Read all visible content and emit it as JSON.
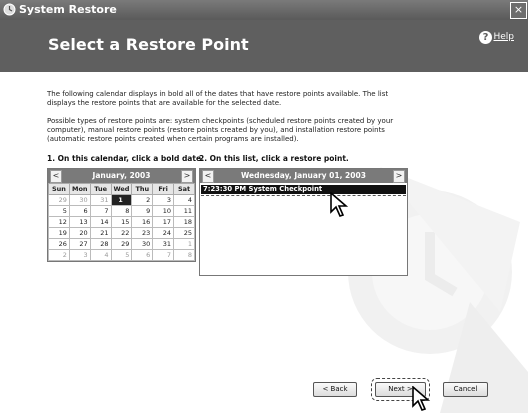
{
  "window": {
    "title": "System Restore",
    "close_label": "×"
  },
  "header": {
    "heading": "Select a Restore Point",
    "help_label": "Help"
  },
  "intro": {
    "paragraph1": "The following calendar displays in bold all of the dates that have restore points available. The list displays the restore points that are available for the selected date.",
    "paragraph2": "Possible types of restore points are: system checkpoints (scheduled restore points created by your computer), manual restore points (restore points created by you), and installation restore points (automatic restore points created when certain programs are installed)."
  },
  "steps": {
    "calendar": "1. On this calendar, click a bold date.",
    "list": "2. On this list, click a restore point."
  },
  "calendar": {
    "month_label": "January, 2003",
    "prev": "<",
    "next": ">",
    "weekdays": [
      "Sun",
      "Mon",
      "Tue",
      "Wed",
      "Thu",
      "Fri",
      "Sat"
    ],
    "weeks": [
      [
        "29",
        "30",
        "31",
        "1",
        "2",
        "3",
        "4"
      ],
      [
        "5",
        "6",
        "7",
        "8",
        "9",
        "10",
        "11"
      ],
      [
        "12",
        "13",
        "14",
        "15",
        "16",
        "17",
        "18"
      ],
      [
        "19",
        "20",
        "21",
        "22",
        "23",
        "24",
        "25"
      ],
      [
        "26",
        "27",
        "28",
        "29",
        "30",
        "31",
        "1"
      ],
      [
        "2",
        "3",
        "4",
        "5",
        "6",
        "7",
        "8"
      ]
    ],
    "selected_day": "1"
  },
  "restore_list": {
    "date_label": "Wednesday, January 01, 2003",
    "prev": "<",
    "next": ">",
    "items": [
      "7:23:30 PM  System Checkpoint"
    ]
  },
  "buttons": {
    "back": "< Back",
    "next": "Next >",
    "cancel": "Cancel"
  },
  "colors": {
    "title_bar": "#6a6a6a",
    "header": "#5f5f5f",
    "selection": "#111111"
  }
}
